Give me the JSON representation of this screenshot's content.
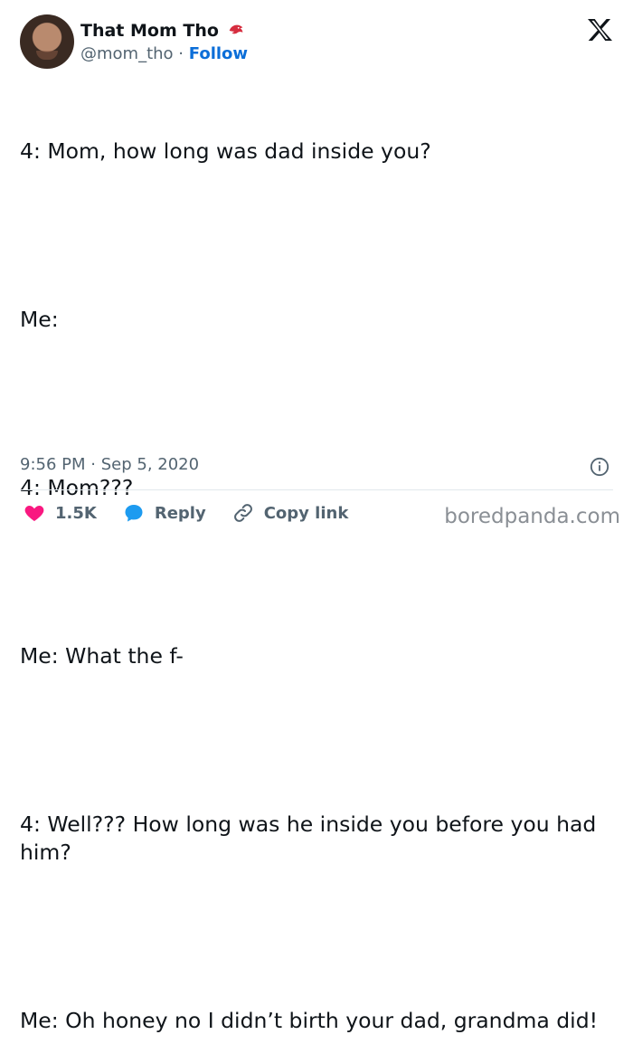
{
  "author": {
    "display_name": "That Mom Tho",
    "handle": "@mom_tho",
    "separator": "·",
    "follow_label": "Follow"
  },
  "tweet": {
    "lines": [
      "4: Mom, how long was dad inside you?",
      "",
      "Me:",
      "",
      "4: Mom???",
      "",
      "Me: What the f-",
      "",
      "4: Well??? How long was he inside you before you had him?",
      "",
      "Me: Oh honey no I didn’t birth your dad, grandma did!"
    ],
    "time": "9:56 PM",
    "date": "Sep 5, 2020",
    "date_separator": "·"
  },
  "actions": {
    "like_count": "1.5K",
    "reply_label": "Reply",
    "copy_link_label": "Copy link"
  },
  "watermark": "boredpanda.com",
  "colors": {
    "like": "#f91880",
    "reply": "#1d9bf0",
    "follow": "#0b6ed8",
    "muted": "#536471",
    "bird_badge": "#d62d3f"
  },
  "icons": {
    "bird_badge": "red-bird-icon",
    "x_logo": "x-logo-icon",
    "info": "info-icon",
    "like": "heart-icon",
    "reply": "speech-bubble-icon",
    "copy": "link-icon"
  }
}
